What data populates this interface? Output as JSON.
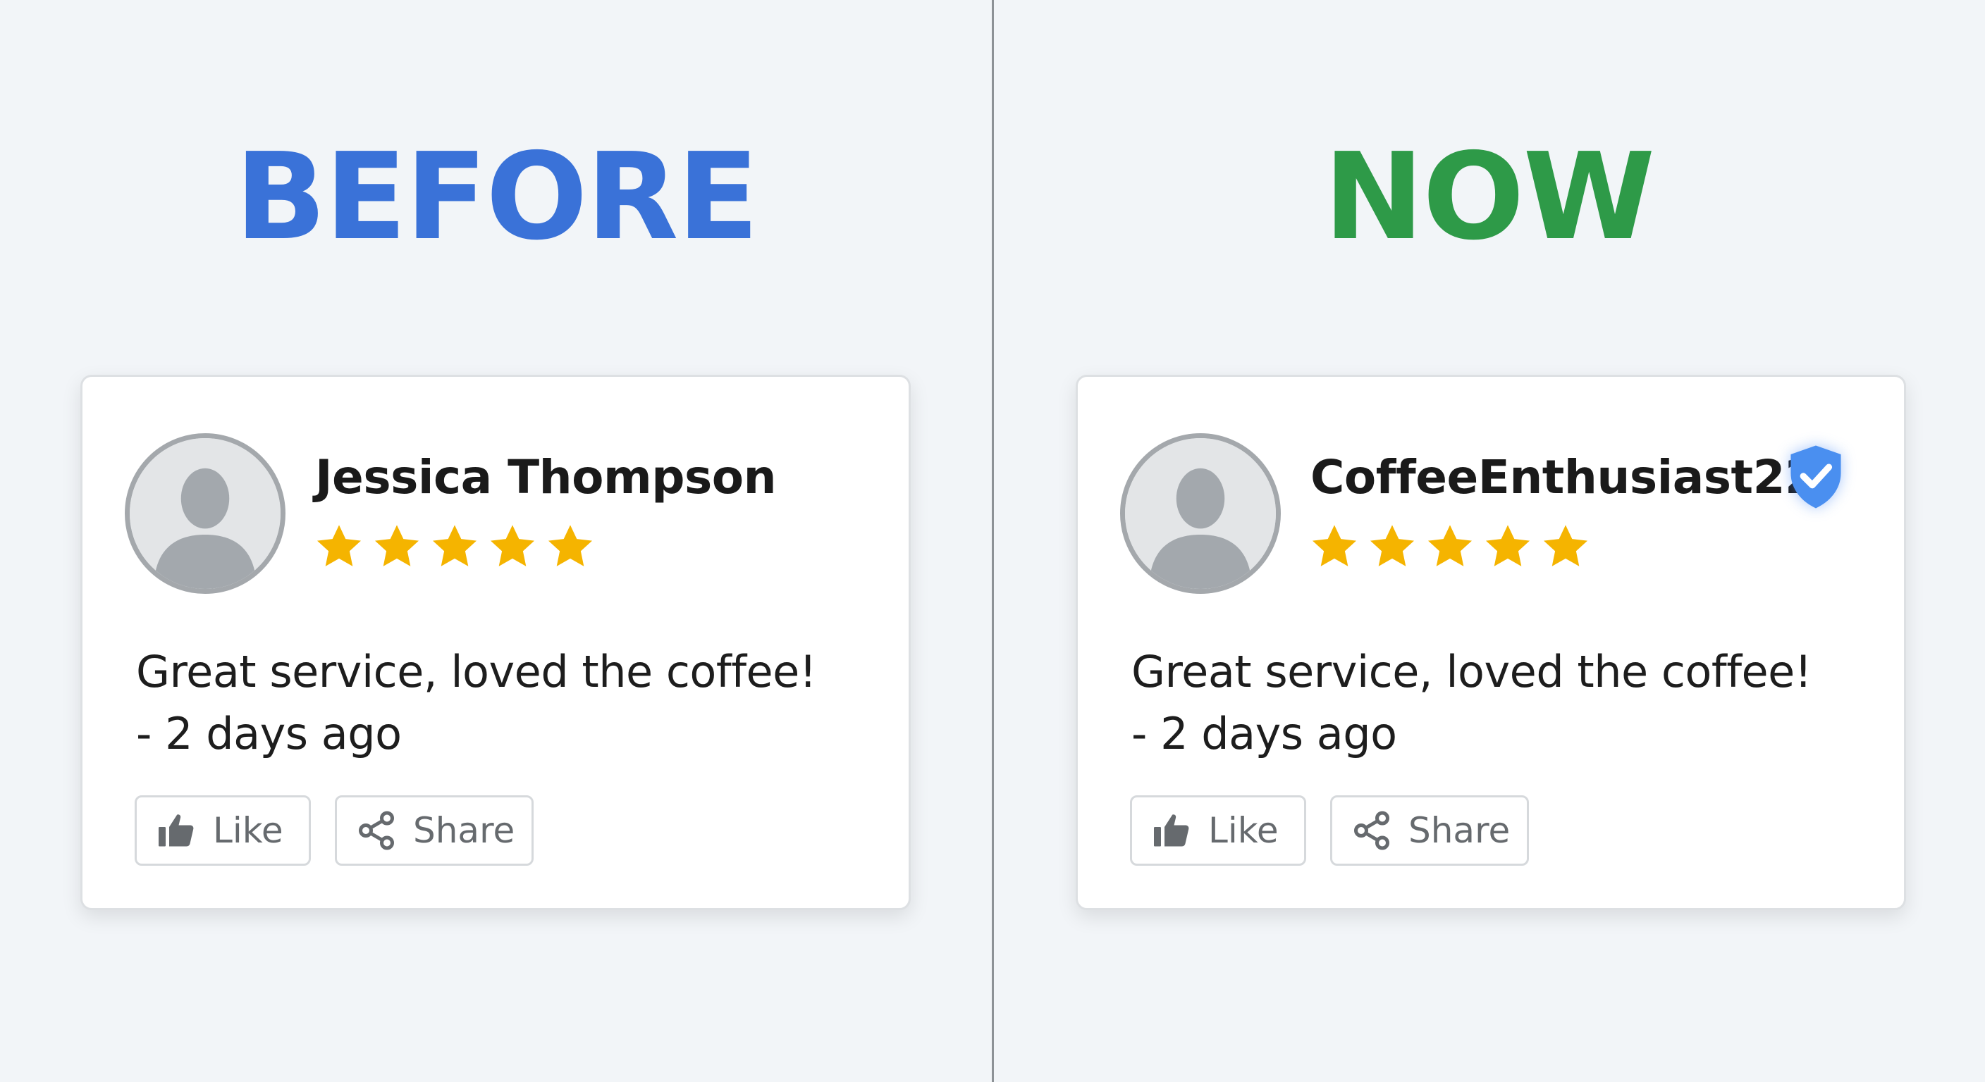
{
  "colors": {
    "before_heading": "#3a72d8",
    "now_heading": "#2e9a48",
    "star": "#f5b400",
    "verified_badge": "#4a8ff0"
  },
  "icons": [
    "person-silhouette-icon",
    "star-icon",
    "verified-shield-icon",
    "thumbs-up-icon",
    "share-icon"
  ],
  "panels": [
    {
      "heading": "BEFORE",
      "review": {
        "username": "Jessica Thompson",
        "rating": 5,
        "rating_max": 5,
        "verified": false,
        "text": "Great service, loved the coffee!",
        "time": "- 2 days ago",
        "like_label": "Like",
        "share_label": "Share"
      }
    },
    {
      "heading": "NOW",
      "review": {
        "username": "CoffeeEnthusiast22",
        "rating": 5,
        "rating_max": 5,
        "verified": true,
        "text": "Great service, loved the coffee!",
        "time": "- 2 days ago",
        "like_label": "Like",
        "share_label": "Share"
      }
    }
  ]
}
